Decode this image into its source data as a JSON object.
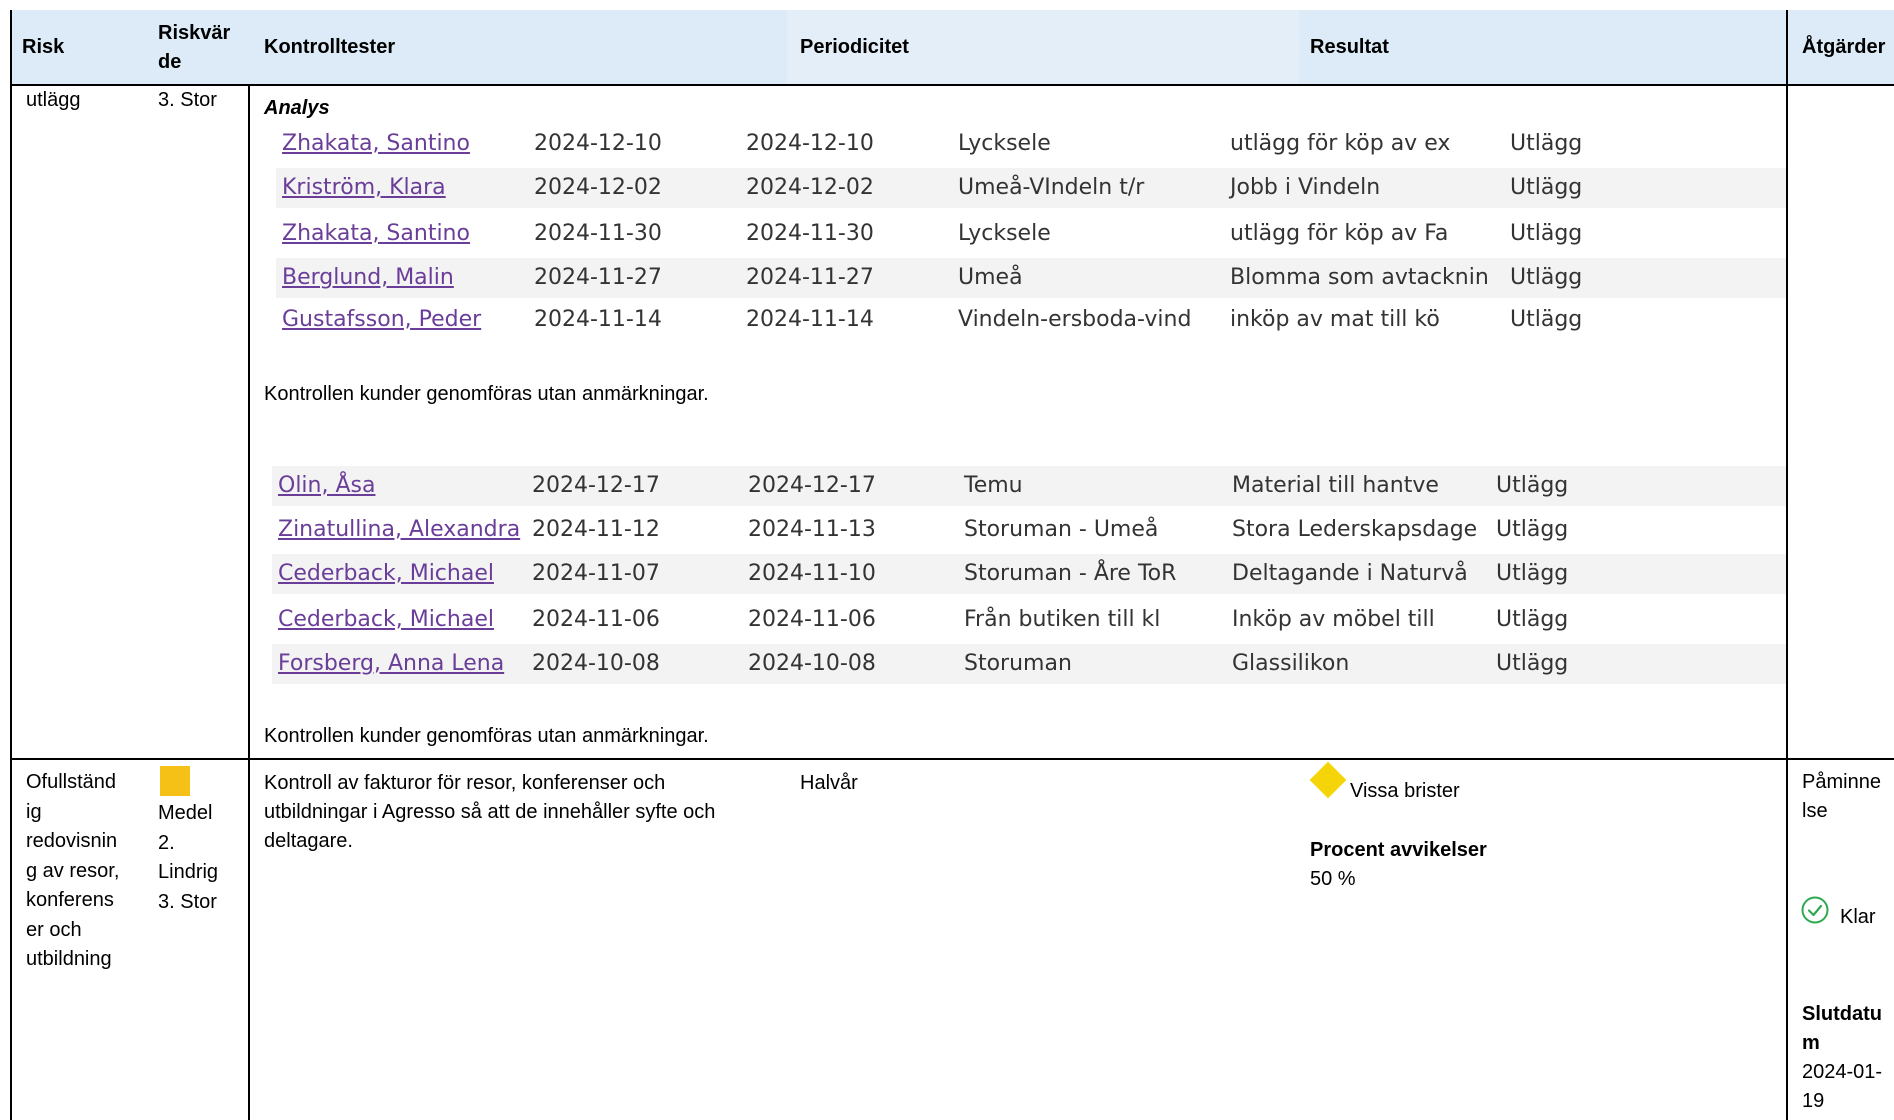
{
  "header": {
    "risk": "Risk",
    "riskvarde": "Riskvär de",
    "kontrolltester": "Kontrolltester",
    "periodicitet": "Periodicitet",
    "resultat": "Resultat",
    "atgarder": "Åtgärder"
  },
  "row1": {
    "risk": "utlägg",
    "riskvarde": "3. Stor",
    "analys_label": "Analys",
    "table1": [
      {
        "name": "Zhakata, Santino",
        "from": "2024-12-10",
        "to": "2024-12-10",
        "place": "Lycksele",
        "desc": "utlägg för köp av ex",
        "type": "Utlägg"
      },
      {
        "name": "Kriström, Klara",
        "from": "2024-12-02",
        "to": "2024-12-02",
        "place": "Umeå-VIndeln t/r",
        "desc": "Jobb i Vindeln",
        "type": "Utlägg"
      },
      {
        "name": "Zhakata, Santino",
        "from": "2024-11-30",
        "to": "2024-11-30",
        "place": "Lycksele",
        "desc": "utlägg för köp av Fa",
        "type": "Utlägg"
      },
      {
        "name": "Berglund, Malin",
        "from": "2024-11-27",
        "to": "2024-11-27",
        "place": "Umeå",
        "desc": "Blomma som avtacknin",
        "type": "Utlägg"
      },
      {
        "name": "Gustafsson, Peder",
        "from": "2024-11-14",
        "to": "2024-11-14",
        "place": "Vindeln-ersboda-vind",
        "desc": "inköp av mat till kö",
        "type": "Utlägg"
      }
    ],
    "note1": "Kontrollen kunder genomföras utan anmärkningar.",
    "table2": [
      {
        "name": "Olin, Åsa",
        "from": "2024-12-17",
        "to": "2024-12-17",
        "place": "Temu",
        "desc": "Material till hantve",
        "type": "Utlägg"
      },
      {
        "name": "Zinatullina, Alexandra",
        "from": "2024-11-12",
        "to": "2024-11-13",
        "place": "Storuman - Umeå",
        "desc": "Stora Lederskapsdage",
        "type": "Utlägg"
      },
      {
        "name": "Cederback, Michael",
        "from": "2024-11-07",
        "to": "2024-11-10",
        "place": "Storuman - Åre ToR",
        "desc": "Deltagande i Naturvå",
        "type": "Utlägg"
      },
      {
        "name": "Cederback, Michael",
        "from": "2024-11-06",
        "to": "2024-11-06",
        "place": "Från butiken till kl",
        "desc": "Inköp av möbel till",
        "type": "Utlägg"
      },
      {
        "name": "Forsberg, Anna Lena",
        "from": "2024-10-08",
        "to": "2024-10-08",
        "place": "Storuman",
        "desc": "Glassilikon",
        "type": "Utlägg"
      }
    ],
    "note2": "Kontrollen kunder genomföras utan anmärkningar."
  },
  "row2": {
    "risk_lines": [
      "Ofullständ",
      "ig",
      "redovisnin",
      "g av resor,",
      "konferens",
      "er och",
      "utbildning"
    ],
    "riskvarde_lines": [
      "Medel",
      "2.",
      "Lindrig",
      "3. Stor"
    ],
    "swatch_color": "#f5c116",
    "kontroll_lines": [
      "Kontroll av fakturor för resor, konferenser och",
      "utbildningar i Agresso så att de innehåller syfte och",
      "deltagare."
    ],
    "periodicitet": "Halvår",
    "resultat_status": "Vissa brister",
    "status_color": "#f5d50a",
    "procent_label": "Procent avvikelser",
    "procent_value": "50 %",
    "atgard_lines": [
      "Påminne",
      "lse"
    ],
    "klar": "Klar",
    "klar_color": "#2fa84f",
    "slutdatum_lines": [
      "Slutdatu",
      "m"
    ],
    "slutdatum_value_lines": [
      "2024-01-",
      "19"
    ]
  }
}
